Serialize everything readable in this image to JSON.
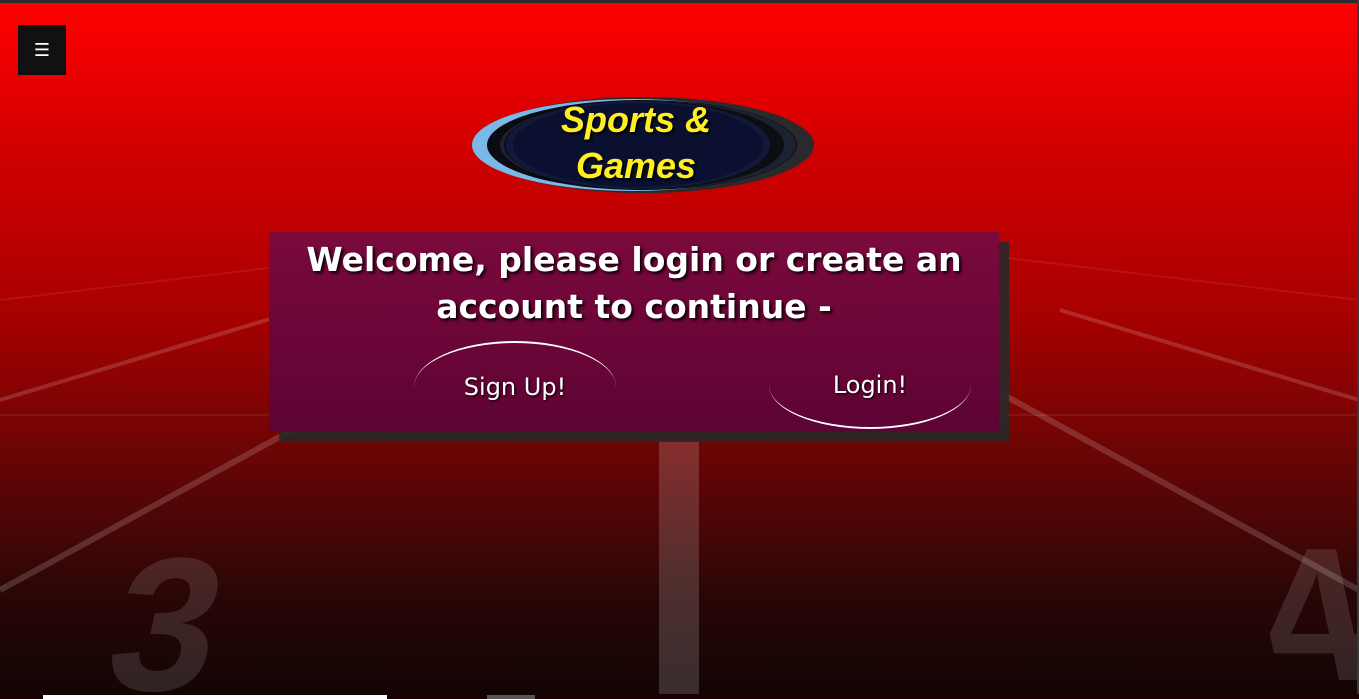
{
  "menu": {
    "icon": "hamburger-menu-icon",
    "glyph": "☰"
  },
  "logo": {
    "line1": "Sports &",
    "line2": "Games"
  },
  "welcome": {
    "line1": "Welcome, please login or create an",
    "line2": "account to continue -"
  },
  "buttons": {
    "signup_label": "Sign Up!",
    "login_label": "Login!"
  },
  "background": {
    "lane_numbers": [
      "3",
      "4"
    ]
  },
  "colors": {
    "background_top": "#ff0000",
    "card": "#6e0639",
    "logo_text": "#ffee22",
    "logo_ring": "#7ab8e8"
  }
}
